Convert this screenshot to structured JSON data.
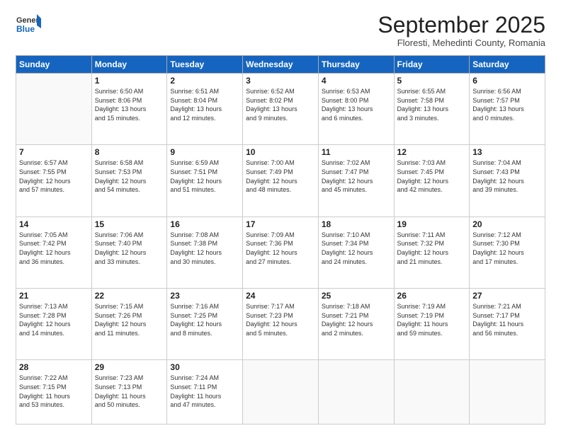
{
  "header": {
    "logo_line1": "General",
    "logo_line2": "Blue",
    "month": "September 2025",
    "location": "Floresti, Mehedinti County, Romania"
  },
  "weekdays": [
    "Sunday",
    "Monday",
    "Tuesday",
    "Wednesday",
    "Thursday",
    "Friday",
    "Saturday"
  ],
  "weeks": [
    [
      {
        "day": "",
        "info": ""
      },
      {
        "day": "1",
        "info": "Sunrise: 6:50 AM\nSunset: 8:06 PM\nDaylight: 13 hours\nand 15 minutes."
      },
      {
        "day": "2",
        "info": "Sunrise: 6:51 AM\nSunset: 8:04 PM\nDaylight: 13 hours\nand 12 minutes."
      },
      {
        "day": "3",
        "info": "Sunrise: 6:52 AM\nSunset: 8:02 PM\nDaylight: 13 hours\nand 9 minutes."
      },
      {
        "day": "4",
        "info": "Sunrise: 6:53 AM\nSunset: 8:00 PM\nDaylight: 13 hours\nand 6 minutes."
      },
      {
        "day": "5",
        "info": "Sunrise: 6:55 AM\nSunset: 7:58 PM\nDaylight: 13 hours\nand 3 minutes."
      },
      {
        "day": "6",
        "info": "Sunrise: 6:56 AM\nSunset: 7:57 PM\nDaylight: 13 hours\nand 0 minutes."
      }
    ],
    [
      {
        "day": "7",
        "info": "Sunrise: 6:57 AM\nSunset: 7:55 PM\nDaylight: 12 hours\nand 57 minutes."
      },
      {
        "day": "8",
        "info": "Sunrise: 6:58 AM\nSunset: 7:53 PM\nDaylight: 12 hours\nand 54 minutes."
      },
      {
        "day": "9",
        "info": "Sunrise: 6:59 AM\nSunset: 7:51 PM\nDaylight: 12 hours\nand 51 minutes."
      },
      {
        "day": "10",
        "info": "Sunrise: 7:00 AM\nSunset: 7:49 PM\nDaylight: 12 hours\nand 48 minutes."
      },
      {
        "day": "11",
        "info": "Sunrise: 7:02 AM\nSunset: 7:47 PM\nDaylight: 12 hours\nand 45 minutes."
      },
      {
        "day": "12",
        "info": "Sunrise: 7:03 AM\nSunset: 7:45 PM\nDaylight: 12 hours\nand 42 minutes."
      },
      {
        "day": "13",
        "info": "Sunrise: 7:04 AM\nSunset: 7:43 PM\nDaylight: 12 hours\nand 39 minutes."
      }
    ],
    [
      {
        "day": "14",
        "info": "Sunrise: 7:05 AM\nSunset: 7:42 PM\nDaylight: 12 hours\nand 36 minutes."
      },
      {
        "day": "15",
        "info": "Sunrise: 7:06 AM\nSunset: 7:40 PM\nDaylight: 12 hours\nand 33 minutes."
      },
      {
        "day": "16",
        "info": "Sunrise: 7:08 AM\nSunset: 7:38 PM\nDaylight: 12 hours\nand 30 minutes."
      },
      {
        "day": "17",
        "info": "Sunrise: 7:09 AM\nSunset: 7:36 PM\nDaylight: 12 hours\nand 27 minutes."
      },
      {
        "day": "18",
        "info": "Sunrise: 7:10 AM\nSunset: 7:34 PM\nDaylight: 12 hours\nand 24 minutes."
      },
      {
        "day": "19",
        "info": "Sunrise: 7:11 AM\nSunset: 7:32 PM\nDaylight: 12 hours\nand 21 minutes."
      },
      {
        "day": "20",
        "info": "Sunrise: 7:12 AM\nSunset: 7:30 PM\nDaylight: 12 hours\nand 17 minutes."
      }
    ],
    [
      {
        "day": "21",
        "info": "Sunrise: 7:13 AM\nSunset: 7:28 PM\nDaylight: 12 hours\nand 14 minutes."
      },
      {
        "day": "22",
        "info": "Sunrise: 7:15 AM\nSunset: 7:26 PM\nDaylight: 12 hours\nand 11 minutes."
      },
      {
        "day": "23",
        "info": "Sunrise: 7:16 AM\nSunset: 7:25 PM\nDaylight: 12 hours\nand 8 minutes."
      },
      {
        "day": "24",
        "info": "Sunrise: 7:17 AM\nSunset: 7:23 PM\nDaylight: 12 hours\nand 5 minutes."
      },
      {
        "day": "25",
        "info": "Sunrise: 7:18 AM\nSunset: 7:21 PM\nDaylight: 12 hours\nand 2 minutes."
      },
      {
        "day": "26",
        "info": "Sunrise: 7:19 AM\nSunset: 7:19 PM\nDaylight: 11 hours\nand 59 minutes."
      },
      {
        "day": "27",
        "info": "Sunrise: 7:21 AM\nSunset: 7:17 PM\nDaylight: 11 hours\nand 56 minutes."
      }
    ],
    [
      {
        "day": "28",
        "info": "Sunrise: 7:22 AM\nSunset: 7:15 PM\nDaylight: 11 hours\nand 53 minutes."
      },
      {
        "day": "29",
        "info": "Sunrise: 7:23 AM\nSunset: 7:13 PM\nDaylight: 11 hours\nand 50 minutes."
      },
      {
        "day": "30",
        "info": "Sunrise: 7:24 AM\nSunset: 7:11 PM\nDaylight: 11 hours\nand 47 minutes."
      },
      {
        "day": "",
        "info": ""
      },
      {
        "day": "",
        "info": ""
      },
      {
        "day": "",
        "info": ""
      },
      {
        "day": "",
        "info": ""
      }
    ]
  ]
}
